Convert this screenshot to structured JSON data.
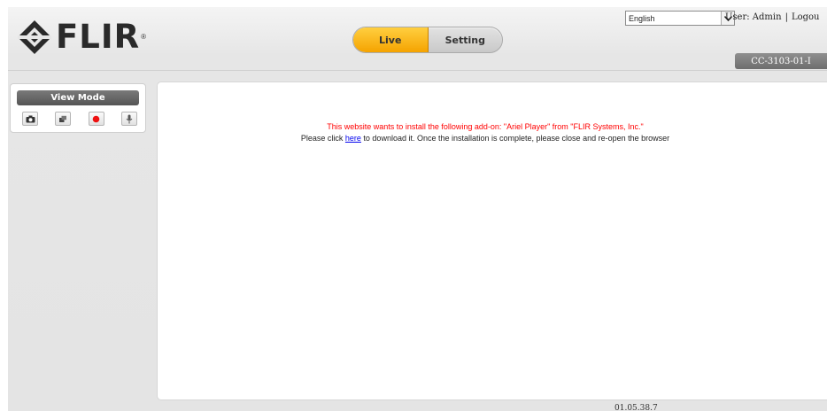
{
  "header": {
    "logo_text": "FLIR",
    "logo_mark": "®",
    "mode_tabs": [
      {
        "label": "Live",
        "active": true
      },
      {
        "label": "Setting",
        "active": false
      }
    ],
    "language": {
      "selected": "English"
    },
    "user_label": "User: Admin",
    "separator": "|",
    "logout_label": "Logou",
    "device_name": "CC-3103-01-I"
  },
  "view_panel": {
    "title": "View Mode",
    "tools": [
      {
        "icon": "camera-icon"
      },
      {
        "icon": "video-clip-icon"
      },
      {
        "icon": "record-icon"
      },
      {
        "icon": "microphone-icon"
      }
    ]
  },
  "content": {
    "install_notice": "This website wants to install the following add-on: \"Ariel Player\" from \"FLIR Systems, Inc.\"",
    "download_prefix": "Please click ",
    "download_link": "here",
    "download_suffix": " to download it. Once the installation is complete, please close and re-open the browser"
  },
  "footer": {
    "version": "01.05.38.7"
  },
  "colors": {
    "live_accent": "#f5a300",
    "notice_red": "#ff0000",
    "link_blue": "#0000ee"
  }
}
